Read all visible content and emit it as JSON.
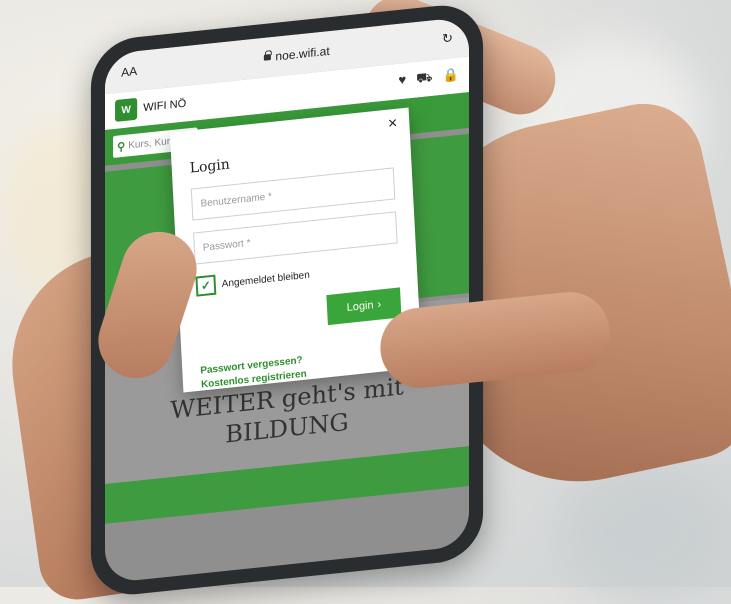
{
  "browser": {
    "text_size_label": "AA",
    "url": "noe.wifi.at",
    "reload_symbol": "↻"
  },
  "site": {
    "logo_text": "W",
    "brand": "WIFI NÖ",
    "search_placeholder": "Kurs, Kur"
  },
  "modal": {
    "title": "Login",
    "close_symbol": "×",
    "username_placeholder": "Benutzername *",
    "password_placeholder": "Passwort *",
    "remember_label": "Angemeldet bleiben",
    "login_button": "Login",
    "forgot_password": "Passwort vergessen?",
    "register": "Kostenlos registrieren"
  },
  "hero": {
    "headline_line1": "WEITER geht's mit",
    "headline_line2": "BILDUNG"
  },
  "colors": {
    "brand_green": "#3aa53a",
    "link_green": "#2f8f2f"
  }
}
